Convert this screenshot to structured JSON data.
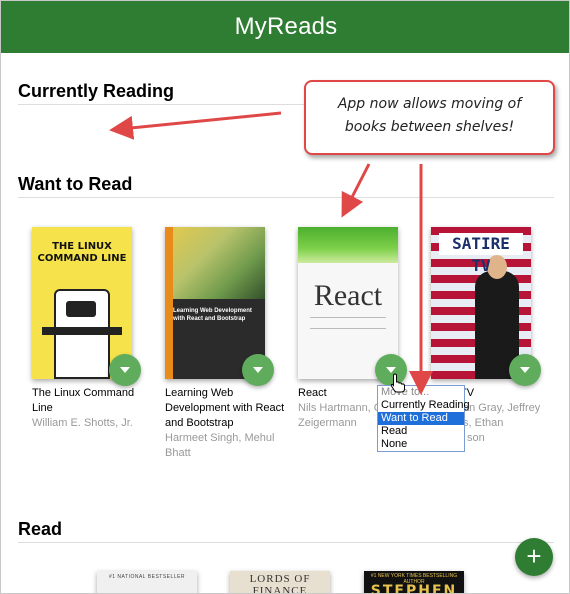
{
  "header": {
    "title": "MyReads"
  },
  "shelves": {
    "currently_reading": "Currently Reading",
    "want_to_read": "Want to Read",
    "read": "Read"
  },
  "books": [
    {
      "title": "The Linux Command Line",
      "author": "William E. Shotts, Jr.",
      "cover_title": "THE LINUX COMMAND LINE"
    },
    {
      "title": "Learning Web Development with React and Bootstrap",
      "author": "Harmeet Singh, Mehul Bhatt",
      "cover_title": "Learning Web Development with React and Bootstrap"
    },
    {
      "title": "React",
      "author": "Nils Hartmann, Oliver Zeigermann",
      "cover_title": "React"
    },
    {
      "title": "Satire TV",
      "author": "Jonathan Gray, Jeffrey P. Jones, Ethan Thompson",
      "cover_title": "SATIRE TV"
    }
  ],
  "visible_text": {
    "book3_author_line1": "Nils Hartmann, Ol",
    "book3_author_line2": "Zeigermann",
    "book4_title_fragment": "TV",
    "book4_author_line1": "an Gray, Jeffrey",
    "book4_author_line2": "s, Ethan",
    "book4_author_line3": "son"
  },
  "move_menu": {
    "header": "Move to...",
    "options": [
      "Currently Reading",
      "Want to Read",
      "Read",
      "None"
    ],
    "selected": "Want to Read"
  },
  "read_shelf_covers": [
    {
      "text": "#1 NATIONAL BESTSELLER"
    },
    {
      "text": "LORDS OF FINANCE"
    },
    {
      "text": "#1 NEW YORK TIMES BESTSELLING AUTHOR",
      "text2": "STEPHEN"
    }
  ],
  "annotation": {
    "line1": "App now allows moving of",
    "line2": "books between shelves!"
  },
  "colors": {
    "header": "#2e7d32",
    "shelf_button": "#60ac5d",
    "annotation_border": "#e04848",
    "selected_option": "#1e6fd9"
  },
  "icons": {
    "shelf_changer": "chevron-down-icon",
    "add_book": "plus-icon",
    "cursor": "hand-pointer-icon"
  }
}
